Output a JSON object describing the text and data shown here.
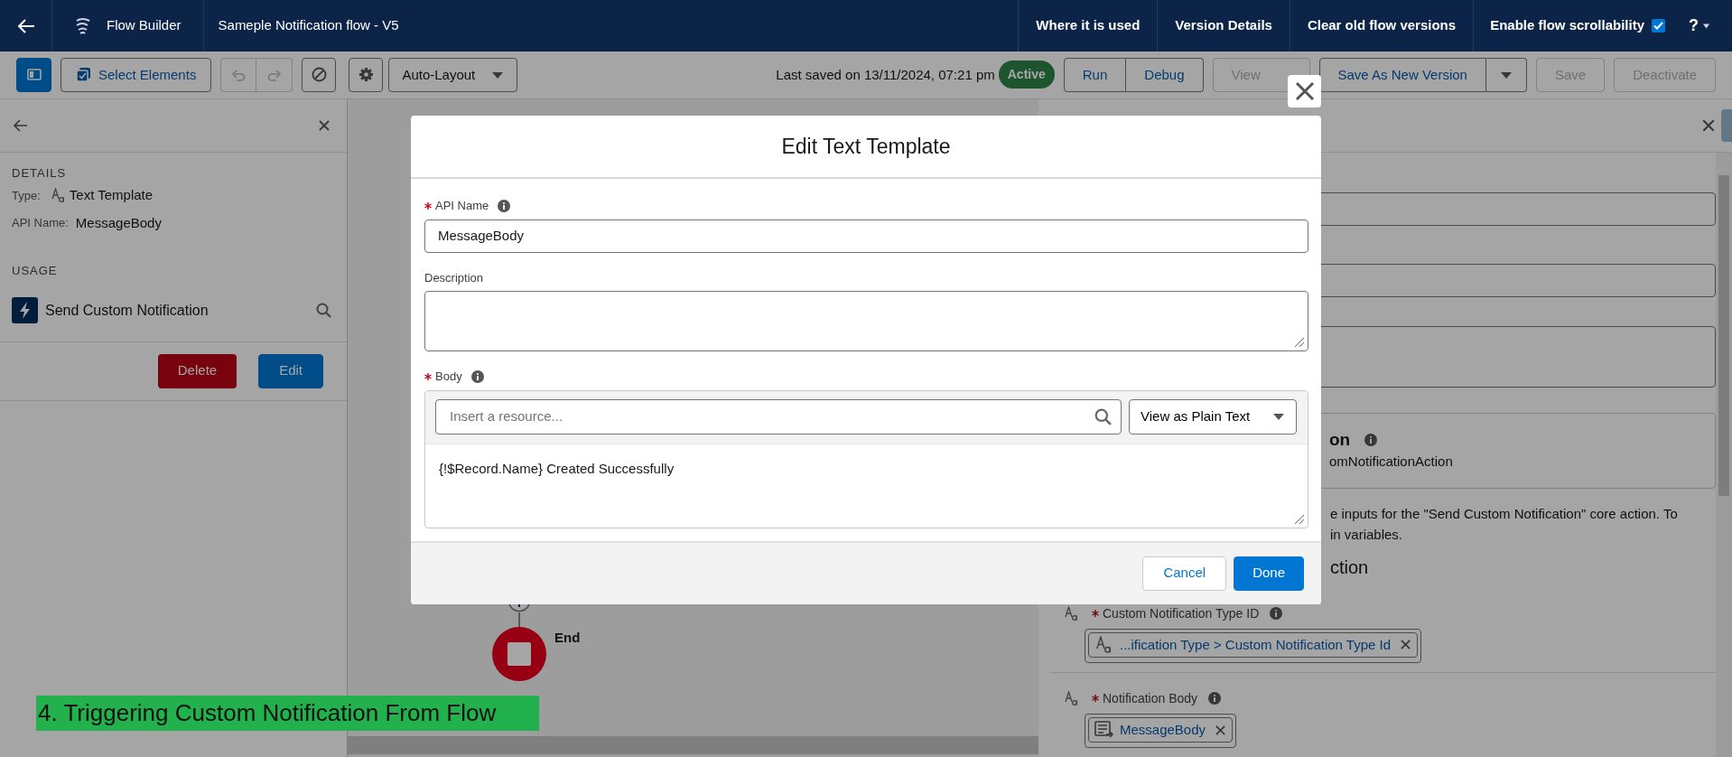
{
  "top_bar": {
    "app_name": "Flow Builder",
    "flow_title": "Sameple Notification flow - V5",
    "links": [
      "Where it is used",
      "Version Details",
      "Clear old flow versions"
    ],
    "scrollability": {
      "label": "Enable flow scrollability",
      "checked": true
    },
    "help": "?"
  },
  "toolbar": {
    "panel_toggle": {
      "selected": true
    },
    "select_elements": "Select Elements",
    "undo": {
      "disabled": true
    },
    "redo": {
      "disabled": true
    },
    "layout": "Auto-Layout",
    "last_saved": "Last saved on 13/11/2024, 07:21 pm",
    "status": "Active",
    "actions": [
      {
        "label": "Run",
        "disabled": false,
        "kind": "group"
      },
      {
        "label": "Debug",
        "disabled": false,
        "kind": "group"
      },
      {
        "label": "View",
        "disabled": true,
        "kind": "single"
      },
      {
        "label": "Save As New Version",
        "disabled": false,
        "kind": "split"
      },
      {
        "label": "Save",
        "disabled": true,
        "kind": "single"
      },
      {
        "label": "Deactivate",
        "disabled": true,
        "kind": "single"
      }
    ]
  },
  "left_panel": {
    "details_heading": "DETAILS",
    "type_label": "Type:",
    "type_value": "Text Template",
    "api_label": "API Name:",
    "api_value": "MessageBody",
    "usage_heading": "USAGE",
    "usage_items": [
      "Send Custom Notification"
    ],
    "buttons": [
      {
        "label": "Delete",
        "kind": "danger"
      },
      {
        "label": "Edit",
        "kind": "brand"
      }
    ]
  },
  "canvas": {
    "end_label": "End"
  },
  "right_panel": {
    "card_title": "on",
    "card_subtitle": "omNotificationAction",
    "help_lines": [
      "e inputs for the \"Send Custom Notification\" core action. To",
      "in variables."
    ],
    "section_title": "ction",
    "inputs": [
      {
        "label": "Custom Notification Type ID",
        "required": true,
        "value": "...ification Type > Custom Notification Type Id",
        "kind": "text"
      },
      {
        "label": "Notification Body",
        "required": true,
        "value": "MessageBody",
        "kind": "template"
      }
    ]
  },
  "modal": {
    "title": "Edit Text Template",
    "fields": [
      {
        "label": "API Name",
        "required": true,
        "info": true,
        "kind": "input",
        "value": "MessageBody"
      },
      {
        "label": "Description",
        "required": false,
        "info": false,
        "kind": "textarea"
      },
      {
        "label": "Body",
        "required": true,
        "info": true,
        "kind": "editor",
        "placeholder": "Insert a resource...",
        "view_mode": "View as Plain Text",
        "value": "{!$Record.Name} Created Successfully"
      }
    ],
    "buttons": [
      {
        "label": "Cancel",
        "kind": "neutral"
      },
      {
        "label": "Done",
        "kind": "brand"
      }
    ]
  },
  "caption": {
    "text": "4. Triggering Custom Notification From Flow"
  }
}
